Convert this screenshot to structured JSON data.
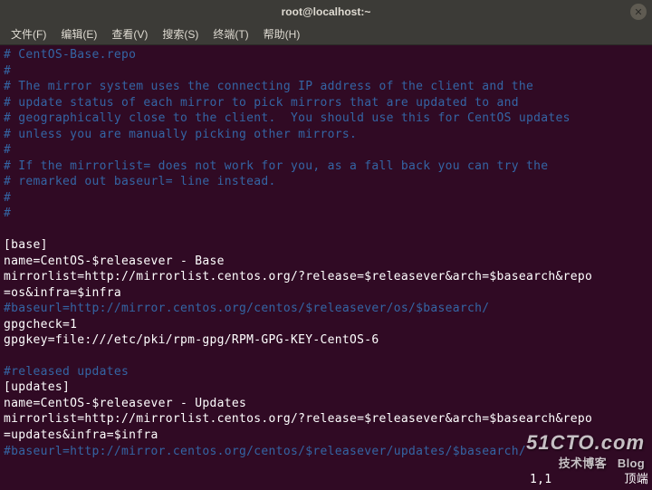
{
  "titlebar": {
    "title": "root@localhost:~"
  },
  "menubar": {
    "file": "文件(F)",
    "edit": "编辑(E)",
    "view": "查看(V)",
    "search": "搜索(S)",
    "terminal": "终端(T)",
    "help": "帮助(H)"
  },
  "content": {
    "l1": "# CentOS-Base.repo",
    "l2": "#",
    "l3": "# The mirror system uses the connecting IP address of the client and the",
    "l4": "# update status of each mirror to pick mirrors that are updated to and",
    "l5": "# geographically close to the client.  You should use this for CentOS updates",
    "l6": "# unless you are manually picking other mirrors.",
    "l7": "#",
    "l8": "# If the mirrorlist= does not work for you, as a fall back you can try the",
    "l9": "# remarked out baseurl= line instead.",
    "l10": "#",
    "l11": "#",
    "l12": "",
    "l13": "[base]",
    "l14": "name=CentOS-$releasever - Base",
    "l15": "mirrorlist=http://mirrorlist.centos.org/?release=$releasever&arch=$basearch&repo",
    "l16": "=os&infra=$infra",
    "l17": "#baseurl=http://mirror.centos.org/centos/$releasever/os/$basearch/",
    "l18": "gpgcheck=1",
    "l19": "gpgkey=file:///etc/pki/rpm-gpg/RPM-GPG-KEY-CentOS-6",
    "l20": "",
    "l21": "#released updates",
    "l22": "[updates]",
    "l23": "name=CentOS-$releasever - Updates",
    "l24": "mirrorlist=http://mirrorlist.centos.org/?release=$releasever&arch=$basearch&repo",
    "l25": "=updates&infra=$infra",
    "l26": "#baseurl=http://mirror.centos.org/centos/$releasever/updates/$basearch/"
  },
  "footer": {
    "pos": "1,1",
    "scroll": "顶端"
  },
  "watermark": {
    "main": "51CTO.com",
    "sub1": "技术博客",
    "sub2": "Blog"
  }
}
